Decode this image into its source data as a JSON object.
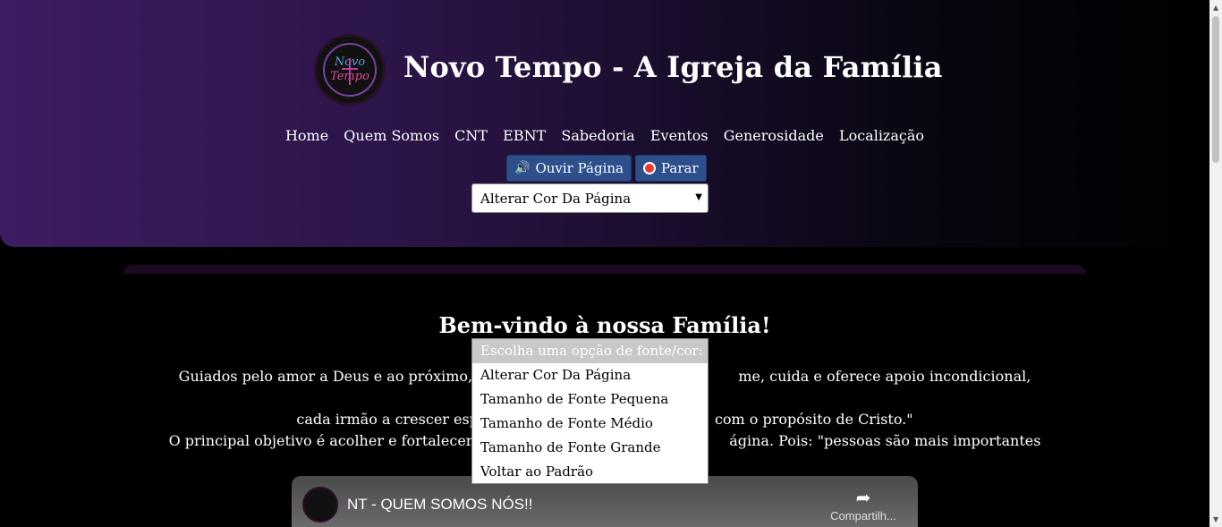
{
  "header": {
    "title": "Novo Tempo - A Igreja da Família",
    "logo_text_top": "Novo",
    "logo_text_bottom": "Tempo"
  },
  "nav": {
    "items": [
      "Home",
      "Quem Somos",
      "CNT",
      "EBNT",
      "Sabedoria",
      "Eventos",
      "Generosidade",
      "Localização"
    ]
  },
  "audio": {
    "listen_label": "Ouvir Página",
    "stop_label": "Parar"
  },
  "select": {
    "value": "Alterar Cor Da Página",
    "options_header": "Escolha uma opção de fonte/cor:",
    "options": [
      "Alterar Cor Da Página",
      "Tamanho de Fonte Pequena",
      "Tamanho de Fonte Médio",
      "Tamanho de Fonte Grande",
      "Voltar ao Padrão"
    ]
  },
  "main": {
    "welcome": "Bem-vindo à nossa Família!",
    "para_line1_left": "Guiados pelo amor a Deus e ao próximo, nos",
    "para_line1_right": "me, cuida e oferece apoio incondicional, ajudando",
    "para_line2_left": "cada irmão a crescer esp",
    "para_line2_right": "com o propósito de Cristo.\"",
    "para_line3_left": "O principal objetivo é acolher e fortalecer es",
    "para_line3_right": "ágina. Pois: \"pessoas são mais importantes que"
  },
  "video": {
    "title": "NT - QUEM SOMOS NÓS!!",
    "share_label": "Compartilh..."
  },
  "colors": {
    "header_start": "#3d1d62",
    "button": "#2d4f8c",
    "stop_icon": "#e83a2f"
  }
}
